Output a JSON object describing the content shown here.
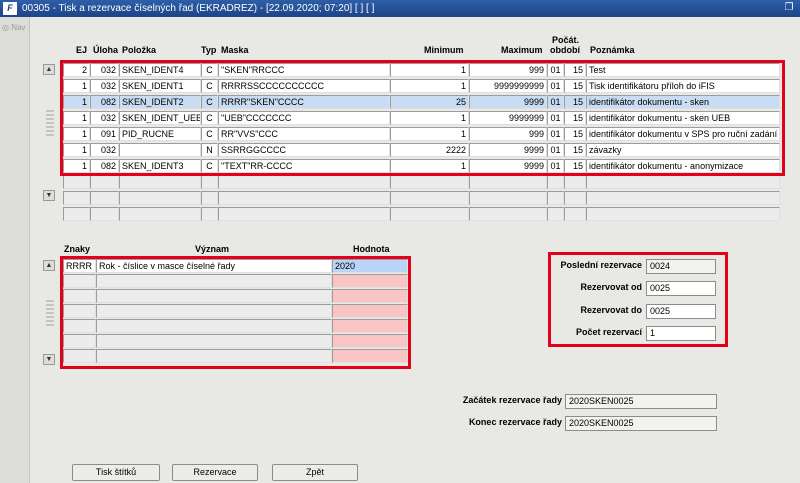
{
  "window": {
    "title": "00305 - Tisk a rezervace číselných řad (EKRADREZ) - [22.09.2020; 07:20]  [ ] [ ]",
    "app_icon": "F",
    "restore_glyph": "❐"
  },
  "nav": {
    "label": "Nav"
  },
  "top_headers": {
    "ej": "EJ",
    "uloha": "Úloha",
    "polozka": "Položka",
    "typ": "Typ",
    "maska": "Maska",
    "minimum": "Minimum",
    "maximum": "Maximum",
    "pocat": "Počát.",
    "obdobi": "období",
    "poznamka": "Poznámka"
  },
  "top_rows": [
    {
      "ej": "2",
      "uloha": "032",
      "polozka": "SKEN_IDENT4",
      "typ": "C",
      "maska": "\"SKEN\"RRCCC",
      "minimum": "1",
      "maximum": "999",
      "obd": "01",
      "pocat": "15",
      "poznamka": "Test"
    },
    {
      "ej": "1",
      "uloha": "032",
      "polozka": "SKEN_IDENT1",
      "typ": "C",
      "maska": "RRRRSSCCCCCCCCCC",
      "minimum": "1",
      "maximum": "9999999999",
      "obd": "01",
      "pocat": "15",
      "poznamka": "Tisk identifikátoru příloh do iFIS"
    },
    {
      "ej": "1",
      "uloha": "082",
      "polozka": "SKEN_IDENT2",
      "typ": "C",
      "maska": "RRRR\"SKEN\"CCCC",
      "minimum": "25",
      "maximum": "9999",
      "obd": "01",
      "pocat": "15",
      "poznamka": "identifikátor dokumentu - sken"
    },
    {
      "ej": "1",
      "uloha": "032",
      "polozka": "SKEN_IDENT_UEB",
      "typ": "C",
      "maska": "\"UEB\"CCCCCCC",
      "minimum": "1",
      "maximum": "9999999",
      "obd": "01",
      "pocat": "15",
      "poznamka": "identifikátor dokumentu - sken UEB"
    },
    {
      "ej": "1",
      "uloha": "091",
      "polozka": "PID_RUCNE",
      "typ": "C",
      "maska": "RR\"VVS\"CCC",
      "minimum": "1",
      "maximum": "999",
      "obd": "01",
      "pocat": "15",
      "poznamka": "identifikátor dokumentu v SPS pro ruční zadání"
    },
    {
      "ej": "1",
      "uloha": "032",
      "polozka": "",
      "typ": "N",
      "maska": "SSRRGGCCCC",
      "minimum": "2222",
      "maximum": "9999",
      "obd": "01",
      "pocat": "15",
      "poznamka": "závazky"
    },
    {
      "ej": "1",
      "uloha": "082",
      "polozka": "SKEN_IDENT3",
      "typ": "C",
      "maska": "\"TEXT\"RR-CCCC",
      "minimum": "1",
      "maximum": "9999",
      "obd": "01",
      "pocat": "15",
      "poznamka": "identifikátor dokumentu - anonymizace"
    }
  ],
  "bottom_headers": {
    "znaky": "Znaky",
    "vyznam": "Význam",
    "hodnota": "Hodnota"
  },
  "bottom_rows": [
    {
      "znaky": "RRRR",
      "vyznam": "Rok - číslice v masce číselné řady",
      "hodnota": "2020"
    }
  ],
  "reservation": {
    "posledni_label": "Poslední rezervace",
    "posledni_value": "0024",
    "od_label": "Rezervovat od",
    "od_value": "0025",
    "do_label": "Rezervovat do",
    "do_value": "0025",
    "pocet_label": "Počet rezervací",
    "pocet_value": "1"
  },
  "range": {
    "zacatek_label": "Začátek rezervace řady",
    "zacatek_value": "2020SKEN0025",
    "konec_label": "Konec rezervace řady",
    "konec_value": "2020SKEN0025"
  },
  "buttons": {
    "tisk": "Tisk štítků",
    "rezervace": "Rezervace",
    "zpet": "Zpět"
  }
}
